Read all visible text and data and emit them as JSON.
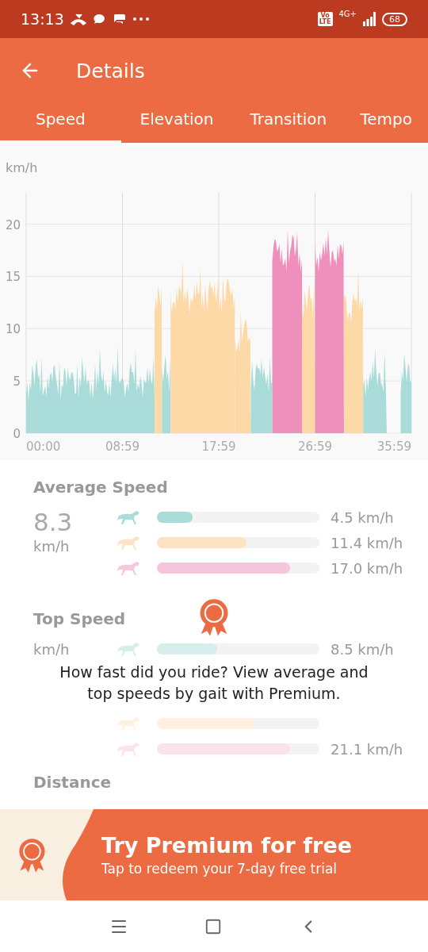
{
  "status_bar": {
    "time": "13:13",
    "network_badge": [
      "Vo",
      "LTE"
    ],
    "network": "4G+",
    "battery": "68"
  },
  "header": {
    "title": "Details"
  },
  "tabs": [
    {
      "label": "Speed",
      "selected": true
    },
    {
      "label": "Elevation",
      "selected": false
    },
    {
      "label": "Transition",
      "selected": false
    },
    {
      "label": "Tempo",
      "selected": false
    }
  ],
  "chart": {
    "unit": "km/h",
    "y_ticks": [
      "20",
      "15",
      "10",
      "5",
      "0"
    ],
    "x_ticks": [
      "00:00",
      "08:59",
      "17:59",
      "26:59",
      "35:59"
    ]
  },
  "average_speed": {
    "title": "Average Speed",
    "value": "8.3",
    "unit": "km/h",
    "gaits": [
      {
        "color": "#a9dcd8",
        "level": 0.22,
        "reading": "4.5 km/h"
      },
      {
        "color": "#fde3c3",
        "level": 0.55,
        "reading": "11.4 km/h"
      },
      {
        "color": "#f6c6dd",
        "level": 0.82,
        "reading": "17.0 km/h"
      }
    ]
  },
  "top_speed": {
    "title": "Top Speed",
    "unit": "km/h",
    "gaits": [
      {
        "color": "#d6efed",
        "level": 0.37,
        "reading": "8.5 km/h"
      },
      {
        "color": "#fff1e0",
        "level": 0.6
      },
      {
        "color": "#fbe3ee",
        "level": 0.82,
        "reading": "21.1 km/h"
      }
    ]
  },
  "distance": {
    "title": "Distance"
  },
  "premium_message": "How fast did you ride? View average and top speeds by gait with Premium.",
  "banner": {
    "title": "Try Premium for free",
    "subtitle": "Tap to redeem your 7-day free trial"
  }
}
